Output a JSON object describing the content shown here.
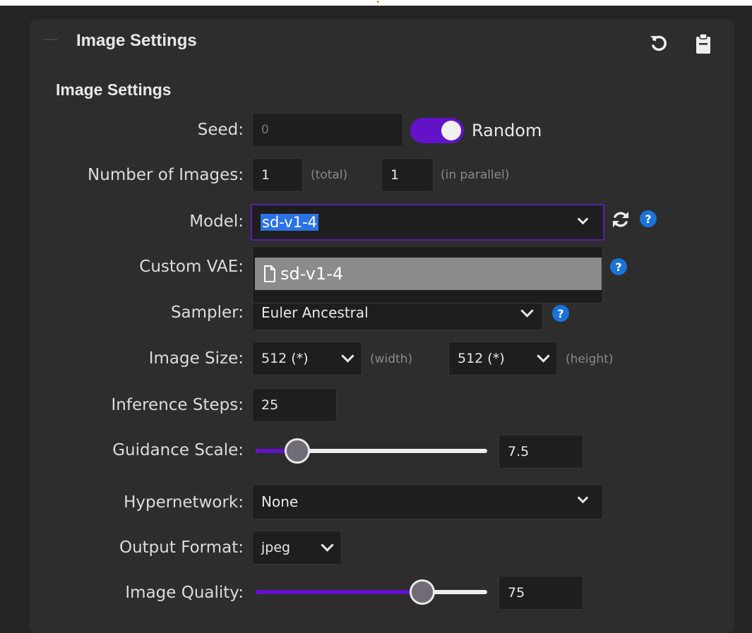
{
  "panel": {
    "title": "Image Settings"
  },
  "section": {
    "title": "Image Settings"
  },
  "seed": {
    "label": "Seed:",
    "value": "0",
    "random_label": "Random",
    "random_enabled": true
  },
  "num_images": {
    "label": "Number of Images:",
    "total": "1",
    "total_hint": "(total)",
    "parallel": "1",
    "parallel_hint": "(in parallel)"
  },
  "model": {
    "label": "Model:",
    "value": "sd-v1-4"
  },
  "model_dropdown": {
    "options": [
      "sd-v1-4"
    ]
  },
  "vae": {
    "label": "Custom VAE:"
  },
  "sampler": {
    "label": "Sampler:",
    "value": "Euler Ancestral"
  },
  "image_size": {
    "label": "Image Size:",
    "width": "512 (*)",
    "width_hint": "(width)",
    "height": "512 (*)",
    "height_hint": "(height)"
  },
  "inference_steps": {
    "label": "Inference Steps:",
    "value": "25"
  },
  "guidance_scale": {
    "label": "Guidance Scale:",
    "value": "7.5",
    "slider_fraction": 0.18
  },
  "hypernetwork": {
    "label": "Hypernetwork:",
    "value": "None"
  },
  "output_format": {
    "label": "Output Format:",
    "value": "jpeg"
  },
  "image_quality": {
    "label": "Image Quality:",
    "value": "75",
    "slider_fraction": 0.72
  },
  "help_symbol": "?",
  "colors": {
    "accent": "#6312c8",
    "help": "#1a73d9",
    "selection": "#2b72e5"
  },
  "icons": [
    "reset-icon",
    "clipboard-icon",
    "refresh-icon",
    "help-icon",
    "file-icon",
    "chevron-down-icon"
  ]
}
